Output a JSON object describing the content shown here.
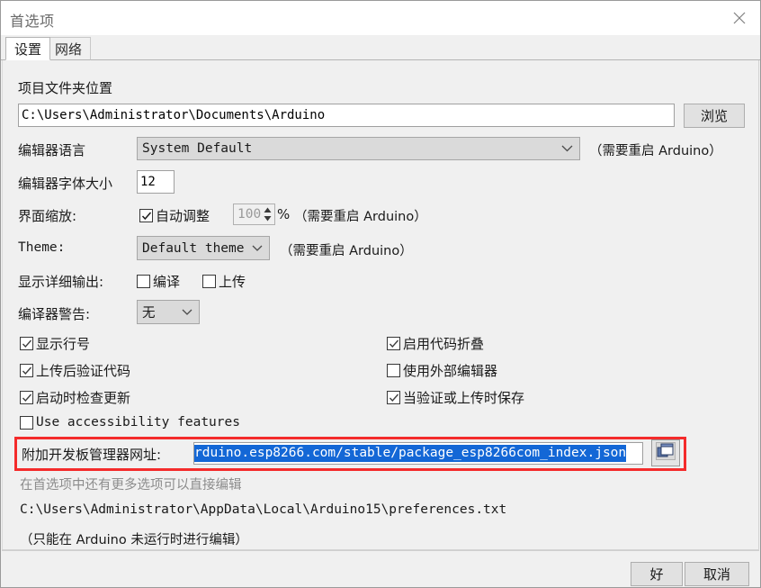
{
  "window": {
    "title": "首选项",
    "close_icon": "close-icon"
  },
  "tabs": [
    {
      "label": "设置",
      "active": true
    },
    {
      "label": "网络",
      "active": false
    }
  ],
  "settings": {
    "sketchbook": {
      "label": "项目文件夹位置",
      "path_value": "C:\\Users\\Administrator\\Documents\\Arduino",
      "browse_label": "浏览"
    },
    "editor_language": {
      "label": "编辑器语言",
      "value": "System Default",
      "restart_note": "（需要重启 Arduino）"
    },
    "editor_font_size": {
      "label": "编辑器字体大小",
      "value": "12"
    },
    "interface_scale": {
      "label": "界面缩放:",
      "auto_label": "自动调整",
      "auto_checked": true,
      "percent_value": "100",
      "percent_symbol": "%",
      "restart_note": "（需要重启 Arduino）"
    },
    "theme": {
      "label": "Theme:",
      "value": "Default theme",
      "restart_note": "（需要重启 Arduino）"
    },
    "verbose_output": {
      "label": "显示详细输出:",
      "compile_label": "编译",
      "compile_checked": false,
      "upload_label": "上传",
      "upload_checked": false
    },
    "compiler_warnings": {
      "label": "编译器警告:",
      "value": "无"
    },
    "checkboxes_left": [
      {
        "label": "显示行号",
        "checked": true,
        "mono": false
      },
      {
        "label": "上传后验证代码",
        "checked": true,
        "mono": false
      },
      {
        "label": "启动时检查更新",
        "checked": true,
        "mono": false
      },
      {
        "label": "Use accessibility features",
        "checked": false,
        "mono": true
      }
    ],
    "checkboxes_right": [
      {
        "label": "启用代码折叠",
        "checked": true,
        "mono": false
      },
      {
        "label": "使用外部编辑器",
        "checked": false,
        "mono": false
      },
      {
        "label": "当验证或上传时保存",
        "checked": true,
        "mono": false
      }
    ],
    "board_urls": {
      "label": "附加开发板管理器网址:",
      "value": "rduino.esp8266.com/stable/package_esp8266com_index.json",
      "selected": true,
      "expand_icon": "windows-icon",
      "highlight_color": "#f42b2b"
    },
    "more_prefs": {
      "hint": "在首选项中还有更多选项可以直接编辑",
      "path": "C:\\Users\\Administrator\\AppData\\Local\\Arduino15\\preferences.txt",
      "edit_note": "（只能在 Arduino 未运行时进行编辑）"
    }
  },
  "footer": {
    "ok_label": "好",
    "cancel_label": "取消"
  }
}
